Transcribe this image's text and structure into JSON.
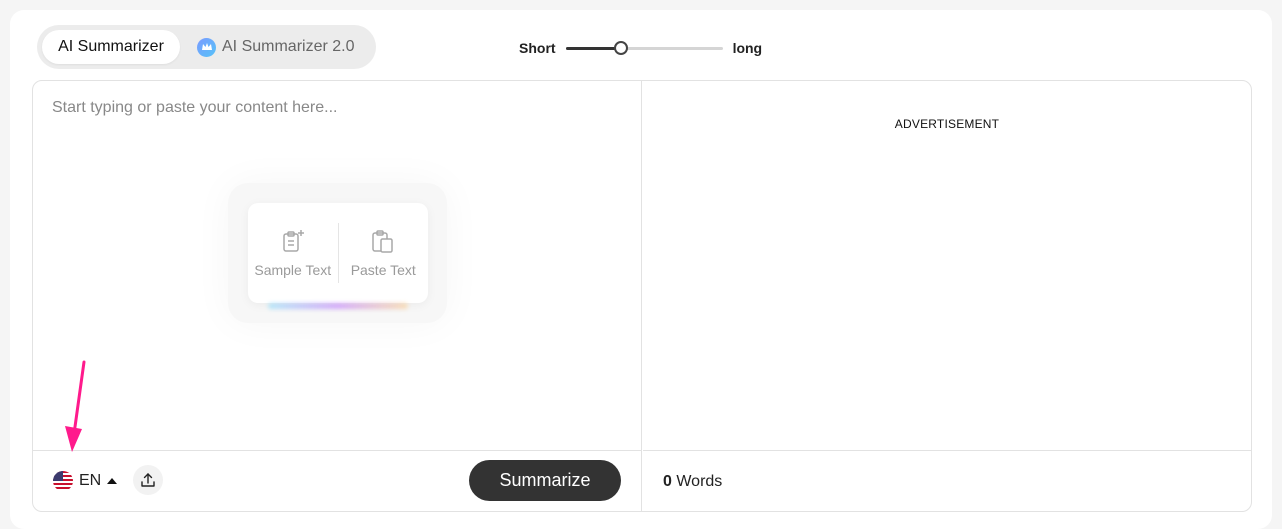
{
  "tabs": [
    {
      "label": "AI Summarizer",
      "active": true
    },
    {
      "label": "AI Summarizer 2.0",
      "active": false,
      "icon": "crown-icon"
    }
  ],
  "length": {
    "short_label": "Short",
    "long_label": "long",
    "value": 0.35
  },
  "editor": {
    "placeholder": "Start typing or paste your content here..."
  },
  "quick_actions": {
    "sample_label": "Sample Text",
    "paste_label": "Paste Text"
  },
  "bottom": {
    "language": "EN",
    "summarize_label": "Summarize"
  },
  "right": {
    "ad_label": "ADVERTISEMENT",
    "word_count": "0",
    "words_label": "Words"
  },
  "colors": {
    "accent_dark": "#333333",
    "annotation_arrow": "#ff1a8c"
  }
}
